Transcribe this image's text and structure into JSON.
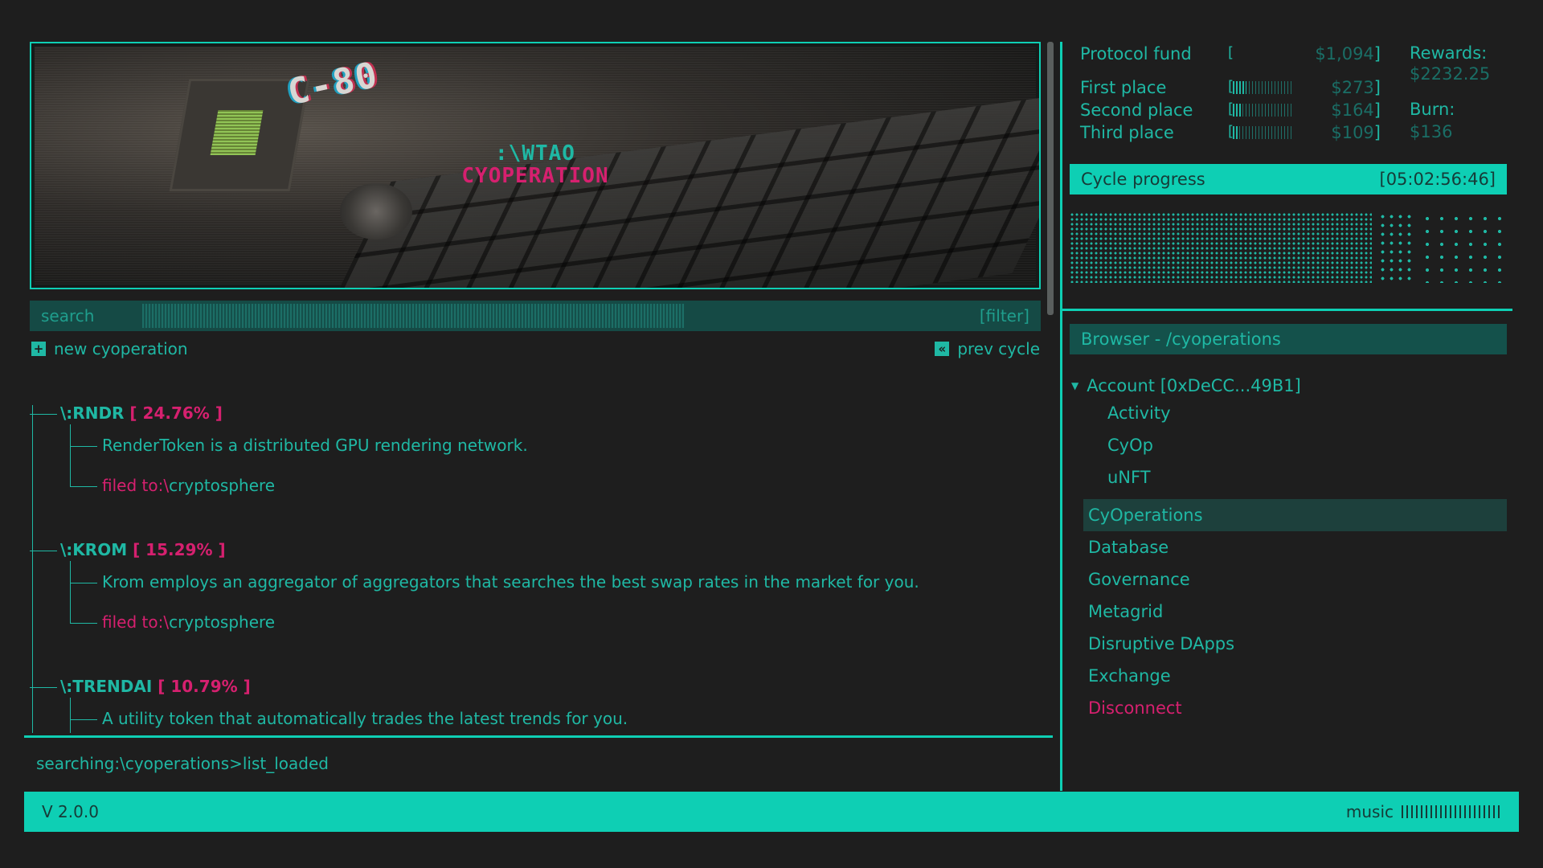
{
  "banner": {
    "brand_line1": ":\\WTAO",
    "brand_line2": "CYOPERATION"
  },
  "search": {
    "placeholder": "search",
    "filter_label": "[filter]"
  },
  "actions": {
    "new_label": "new cyoperation",
    "new_icon": "plus-icon",
    "prev_label": "prev cycle",
    "prev_icon": "double-chevron-left-icon"
  },
  "entries": [
    {
      "ticker": "\\:RNDR",
      "percent": "[ 24.76% ]",
      "description": "RenderToken is a distributed GPU rendering network.",
      "filed_label": "filed to:\\",
      "filed_value": "cryptosphere"
    },
    {
      "ticker": "\\:KROM",
      "percent": "[ 15.29% ]",
      "description": "Krom employs an aggregator of aggregators that searches the best swap rates in the market for you.",
      "filed_label": "filed to:\\",
      "filed_value": "cryptosphere"
    },
    {
      "ticker": "\\:TRENDAI",
      "percent": "[ 10.79% ]",
      "description": "A utility token that automatically trades the latest trends for you."
    }
  ],
  "status": {
    "text": "searching:\\cyoperations>list_loaded"
  },
  "prizes": {
    "rows": [
      {
        "label": "Protocol fund",
        "amount": "$1,094",
        "fill": 0.0
      },
      {
        "label": "First place",
        "amount": "$273",
        "fill": 0.22
      },
      {
        "label": "Second place",
        "amount": "$164",
        "fill": 0.13
      },
      {
        "label": "Third place",
        "amount": "$109",
        "fill": 0.09
      }
    ],
    "rewards_label": "Rewards:",
    "rewards_value": "$2232.25",
    "burn_label": "Burn:",
    "burn_value": "$136"
  },
  "cycle": {
    "label": "Cycle progress",
    "time": "[05:02:56:46]"
  },
  "browser": {
    "header": "Browser - /cyoperations",
    "account": "Account [0xDeCC...49B1]",
    "account_sub": [
      "Activity",
      "CyOp",
      "uNFT"
    ],
    "nav": [
      "CyOperations",
      "Database",
      "Governance",
      "Metagrid",
      "Disruptive DApps",
      "Exchange"
    ],
    "disconnect": "Disconnect",
    "active_item": "CyOperations"
  },
  "footer": {
    "version": "V 2.0.0",
    "music_label": "music"
  },
  "colors": {
    "accent": "#0ecfb4",
    "text": "#1fb8a4",
    "highlight": "#d6206f",
    "background": "#1e1e1e"
  }
}
